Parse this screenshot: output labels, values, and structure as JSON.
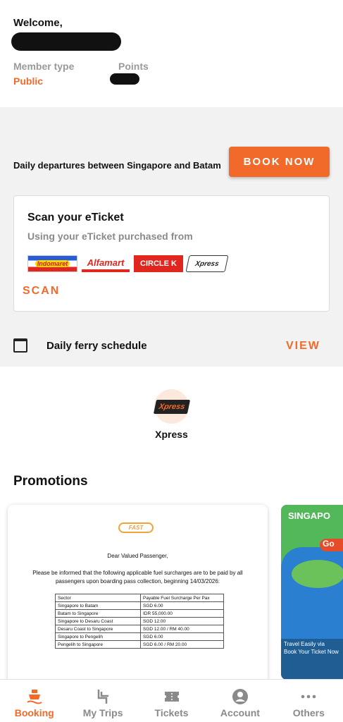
{
  "header": {
    "welcome": "Welcome,",
    "member_type_label": "Member type",
    "points_label": "Points",
    "member_type_value": "Public"
  },
  "booking": {
    "daily_text": "Daily departures between Singapore and Batam",
    "book_now": "BOOK NOW"
  },
  "scan_card": {
    "title": "Scan your eTicket",
    "subtitle": "Using your eTicket purchased from",
    "partners": [
      "Indomaret",
      "Alfamart",
      "CIRCLE K",
      "Xpress"
    ],
    "scan_label": "SCAN"
  },
  "schedule": {
    "label": "Daily ferry schedule",
    "view_label": "VIEW"
  },
  "operator": {
    "logo_text": "Xpress",
    "name": "Xpress"
  },
  "promotions": {
    "title": "Promotions",
    "card1": {
      "brand": "FAST",
      "greeting": "Dear Valued Passenger,",
      "notice": "Please be informed that the following applicable fuel surcharges are to be paid by all passengers upon boarding pass collection, beginning 14/03/2026:",
      "table": [
        [
          "Sector",
          "Payable Fuel Surcharge Per Pax"
        ],
        [
          "Singapore to Batam",
          "SGD 6.00"
        ],
        [
          "Batam to Singapore",
          "IDR 55,000.00"
        ],
        [
          "Singapore to Desaru Coast",
          "SGD 12.00"
        ],
        [
          "Desaru Coast to Singapore",
          "SGD 12.00 / RM 40.00"
        ],
        [
          "Singapore to Pengelih",
          "SGD 6.00"
        ],
        [
          "Pengelih to Singapore",
          "SGD 6.00 / RM 20.00"
        ]
      ]
    },
    "card2": {
      "title": "SINGAPO",
      "go": "Go",
      "line1": "Travel Easily via",
      "line2": "Book Your Ticket Now"
    }
  },
  "nav": [
    {
      "label": "Booking",
      "icon": "ferry-icon",
      "active": true
    },
    {
      "label": "My Trips",
      "icon": "seat-icon",
      "active": false
    },
    {
      "label": "Tickets",
      "icon": "ticket-icon",
      "active": false
    },
    {
      "label": "Account",
      "icon": "account-icon",
      "active": false
    },
    {
      "label": "Others",
      "icon": "more-icon",
      "active": false
    }
  ],
  "colors": {
    "accent": "#f26a2a",
    "muted": "#8a8a8a",
    "section_bg": "#f2f2f2"
  }
}
